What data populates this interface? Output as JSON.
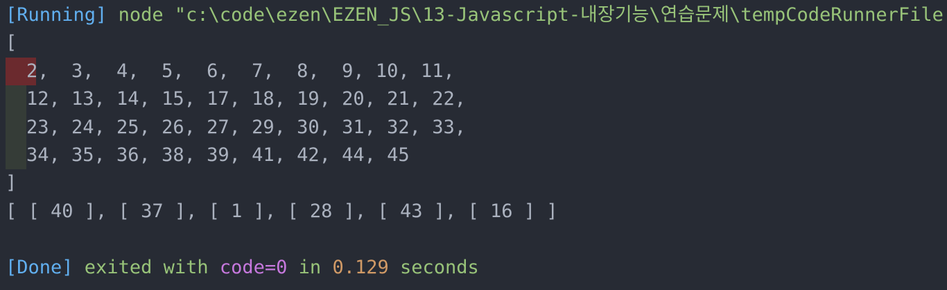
{
  "run": {
    "running_tag": "[Running]",
    "command": " node \"c:\\code\\ezen\\EZEN_JS\\13-Javascript-내장기능\\연습문제\\tempCodeRunnerFile.js\""
  },
  "output": {
    "open_bracket": "[",
    "rows": [
      "2,  3,  4,  5,  6,  7,  8,  9, 10, 11,",
      "12, 13, 14, 15, 17, 18, 19, 20, 21, 22,",
      "23, 24, 25, 26, 27, 29, 30, 31, 32, 33,",
      "34, 35, 36, 38, 39, 41, 42, 44, 45"
    ],
    "close_bracket": "]",
    "picked_line": "[ [ 40 ], [ 37 ], [ 1 ], [ 28 ], [ 43 ], [ 16 ] ]"
  },
  "done": {
    "done_tag": "[Done]",
    "exited_with": " exited with ",
    "code_label": "code=0",
    "in_label": " in ",
    "duration": "0.129",
    "seconds_label": " seconds"
  },
  "colors": {
    "background": "#272b34",
    "tag": "#61afef",
    "text_green": "#98c379",
    "code_purple": "#c678dd",
    "duration_orange": "#d19a66",
    "indent_error": "#6b2a2e",
    "indent_guide": "#353c37"
  }
}
